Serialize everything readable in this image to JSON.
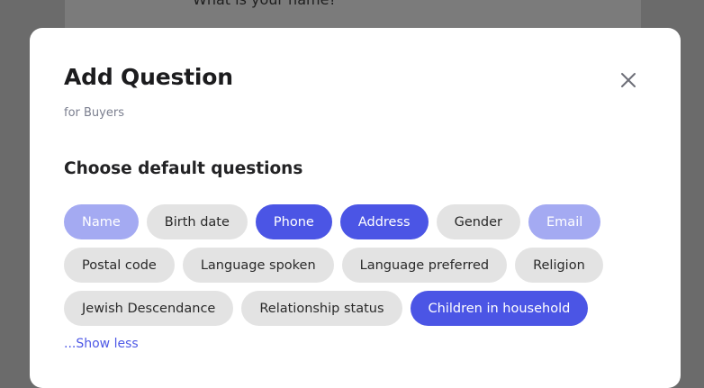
{
  "background": {
    "question_text": "What is your name?"
  },
  "modal": {
    "title": "Add Question",
    "subtitle": "for Buyers",
    "close_icon": "close-icon",
    "section_title": "Choose default questions",
    "chips": [
      {
        "label": "Name",
        "state": "disabled-selected"
      },
      {
        "label": "Birth date",
        "state": "unselected"
      },
      {
        "label": "Phone",
        "state": "selected"
      },
      {
        "label": "Address",
        "state": "selected"
      },
      {
        "label": "Gender",
        "state": "unselected"
      },
      {
        "label": "Email",
        "state": "disabled-selected"
      },
      {
        "label": "Postal code",
        "state": "unselected"
      },
      {
        "label": "Language spoken",
        "state": "unselected"
      },
      {
        "label": "Language preferred",
        "state": "unselected"
      },
      {
        "label": "Religion",
        "state": "unselected"
      },
      {
        "label": "Jewish Descendance",
        "state": "unselected"
      },
      {
        "label": "Relationship status",
        "state": "unselected"
      },
      {
        "label": "Children in household",
        "state": "selected"
      }
    ],
    "show_less_label": "...Show less"
  },
  "colors": {
    "accent": "#4b55e5",
    "accent_soft": "#a4aaf2",
    "chip_unselected": "#e3e3e3",
    "overlay": "#6b6b6b"
  }
}
